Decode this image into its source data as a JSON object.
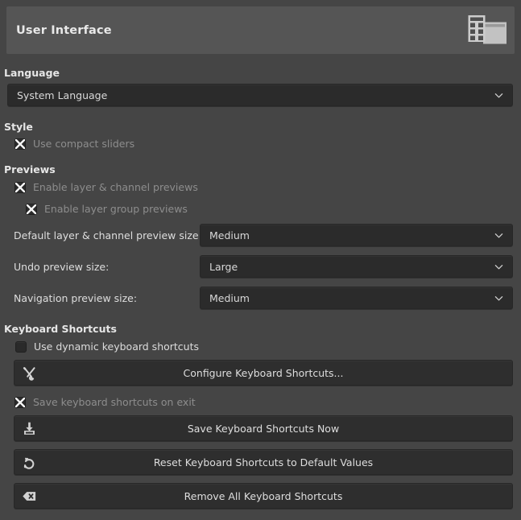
{
  "header": {
    "title": "User Interface",
    "icon": "user-interface-icon"
  },
  "sections": {
    "language": {
      "heading": "Language",
      "combo": {
        "value": "System Language",
        "chevron": "chevron-down-icon"
      }
    },
    "style": {
      "heading": "Style",
      "options": [
        {
          "label": "Use compact sliders",
          "checked": true,
          "enabled": false
        }
      ]
    },
    "previews": {
      "heading": "Previews",
      "options": [
        {
          "label": "Enable layer & channel previews",
          "checked": true,
          "enabled": false
        },
        {
          "label": "Enable layer group previews",
          "checked": true,
          "enabled": false
        }
      ],
      "combos": [
        {
          "label": "Default layer & channel preview size:",
          "value": "Medium",
          "chevron": "chevron-down-icon"
        },
        {
          "label": "Undo preview size:",
          "value": "Large",
          "chevron": "chevron-down-icon"
        },
        {
          "label": "Navigation preview size:",
          "value": "Medium",
          "chevron": "chevron-down-icon"
        }
      ]
    },
    "keyboard_shortcuts": {
      "heading": "Keyboard Shortcuts",
      "options": [
        {
          "label": "Use dynamic keyboard shortcuts",
          "checked": false,
          "enabled": true
        },
        {
          "label": "Save keyboard shortcuts on exit",
          "checked": true,
          "enabled": false
        }
      ],
      "buttons": [
        {
          "label": "Configure Keyboard Shortcuts...",
          "icon": "tools-icon"
        },
        {
          "label": "Save Keyboard Shortcuts Now",
          "icon": "save-icon"
        },
        {
          "label": "Reset Keyboard Shortcuts to Default Values",
          "icon": "reset-icon"
        },
        {
          "label": "Remove All Keyboard Shortcuts",
          "icon": "backspace-delete-icon"
        }
      ]
    }
  },
  "colors": {
    "page_background": "#454545",
    "header_background": "#555555",
    "control_background": "#2b2b2b",
    "button_background": "#2e2e2e",
    "text": "#dedede",
    "text_disabled": "#8d8d8d",
    "icon": "#c8c8c8"
  }
}
